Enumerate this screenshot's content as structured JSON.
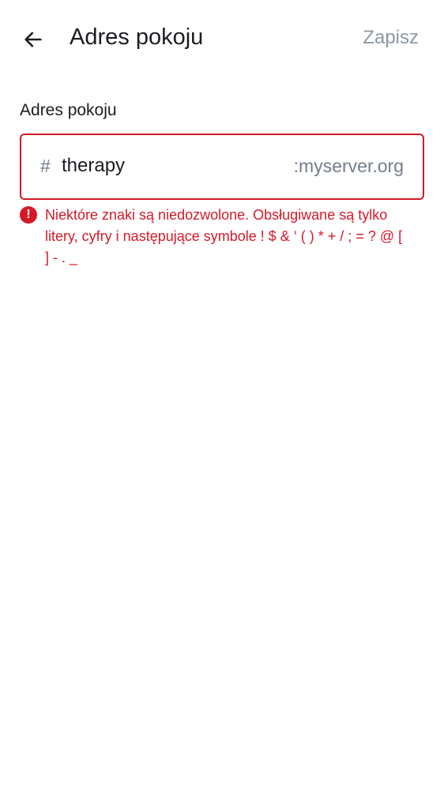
{
  "header": {
    "back_icon": "arrow-left-icon",
    "title": "Adres pokoju",
    "save_label": "Zapisz"
  },
  "address_field": {
    "label": "Adres pokoju",
    "prefix": "#",
    "value": "therapy",
    "suffix": ":myserver.org"
  },
  "error": {
    "icon": "exclamation-circle-icon",
    "message": "Niektóre znaki są niedozwolone. Obsługiwane są tylko litery, cyfry i następujące symbole ! $ & ‘ ( ) * + / ; = ? @ [ ] - . _"
  },
  "colors": {
    "error": "#d51928",
    "muted": "#8d97a5",
    "secondary_text": "#737d8c",
    "primary_text": "#1b1d22"
  }
}
